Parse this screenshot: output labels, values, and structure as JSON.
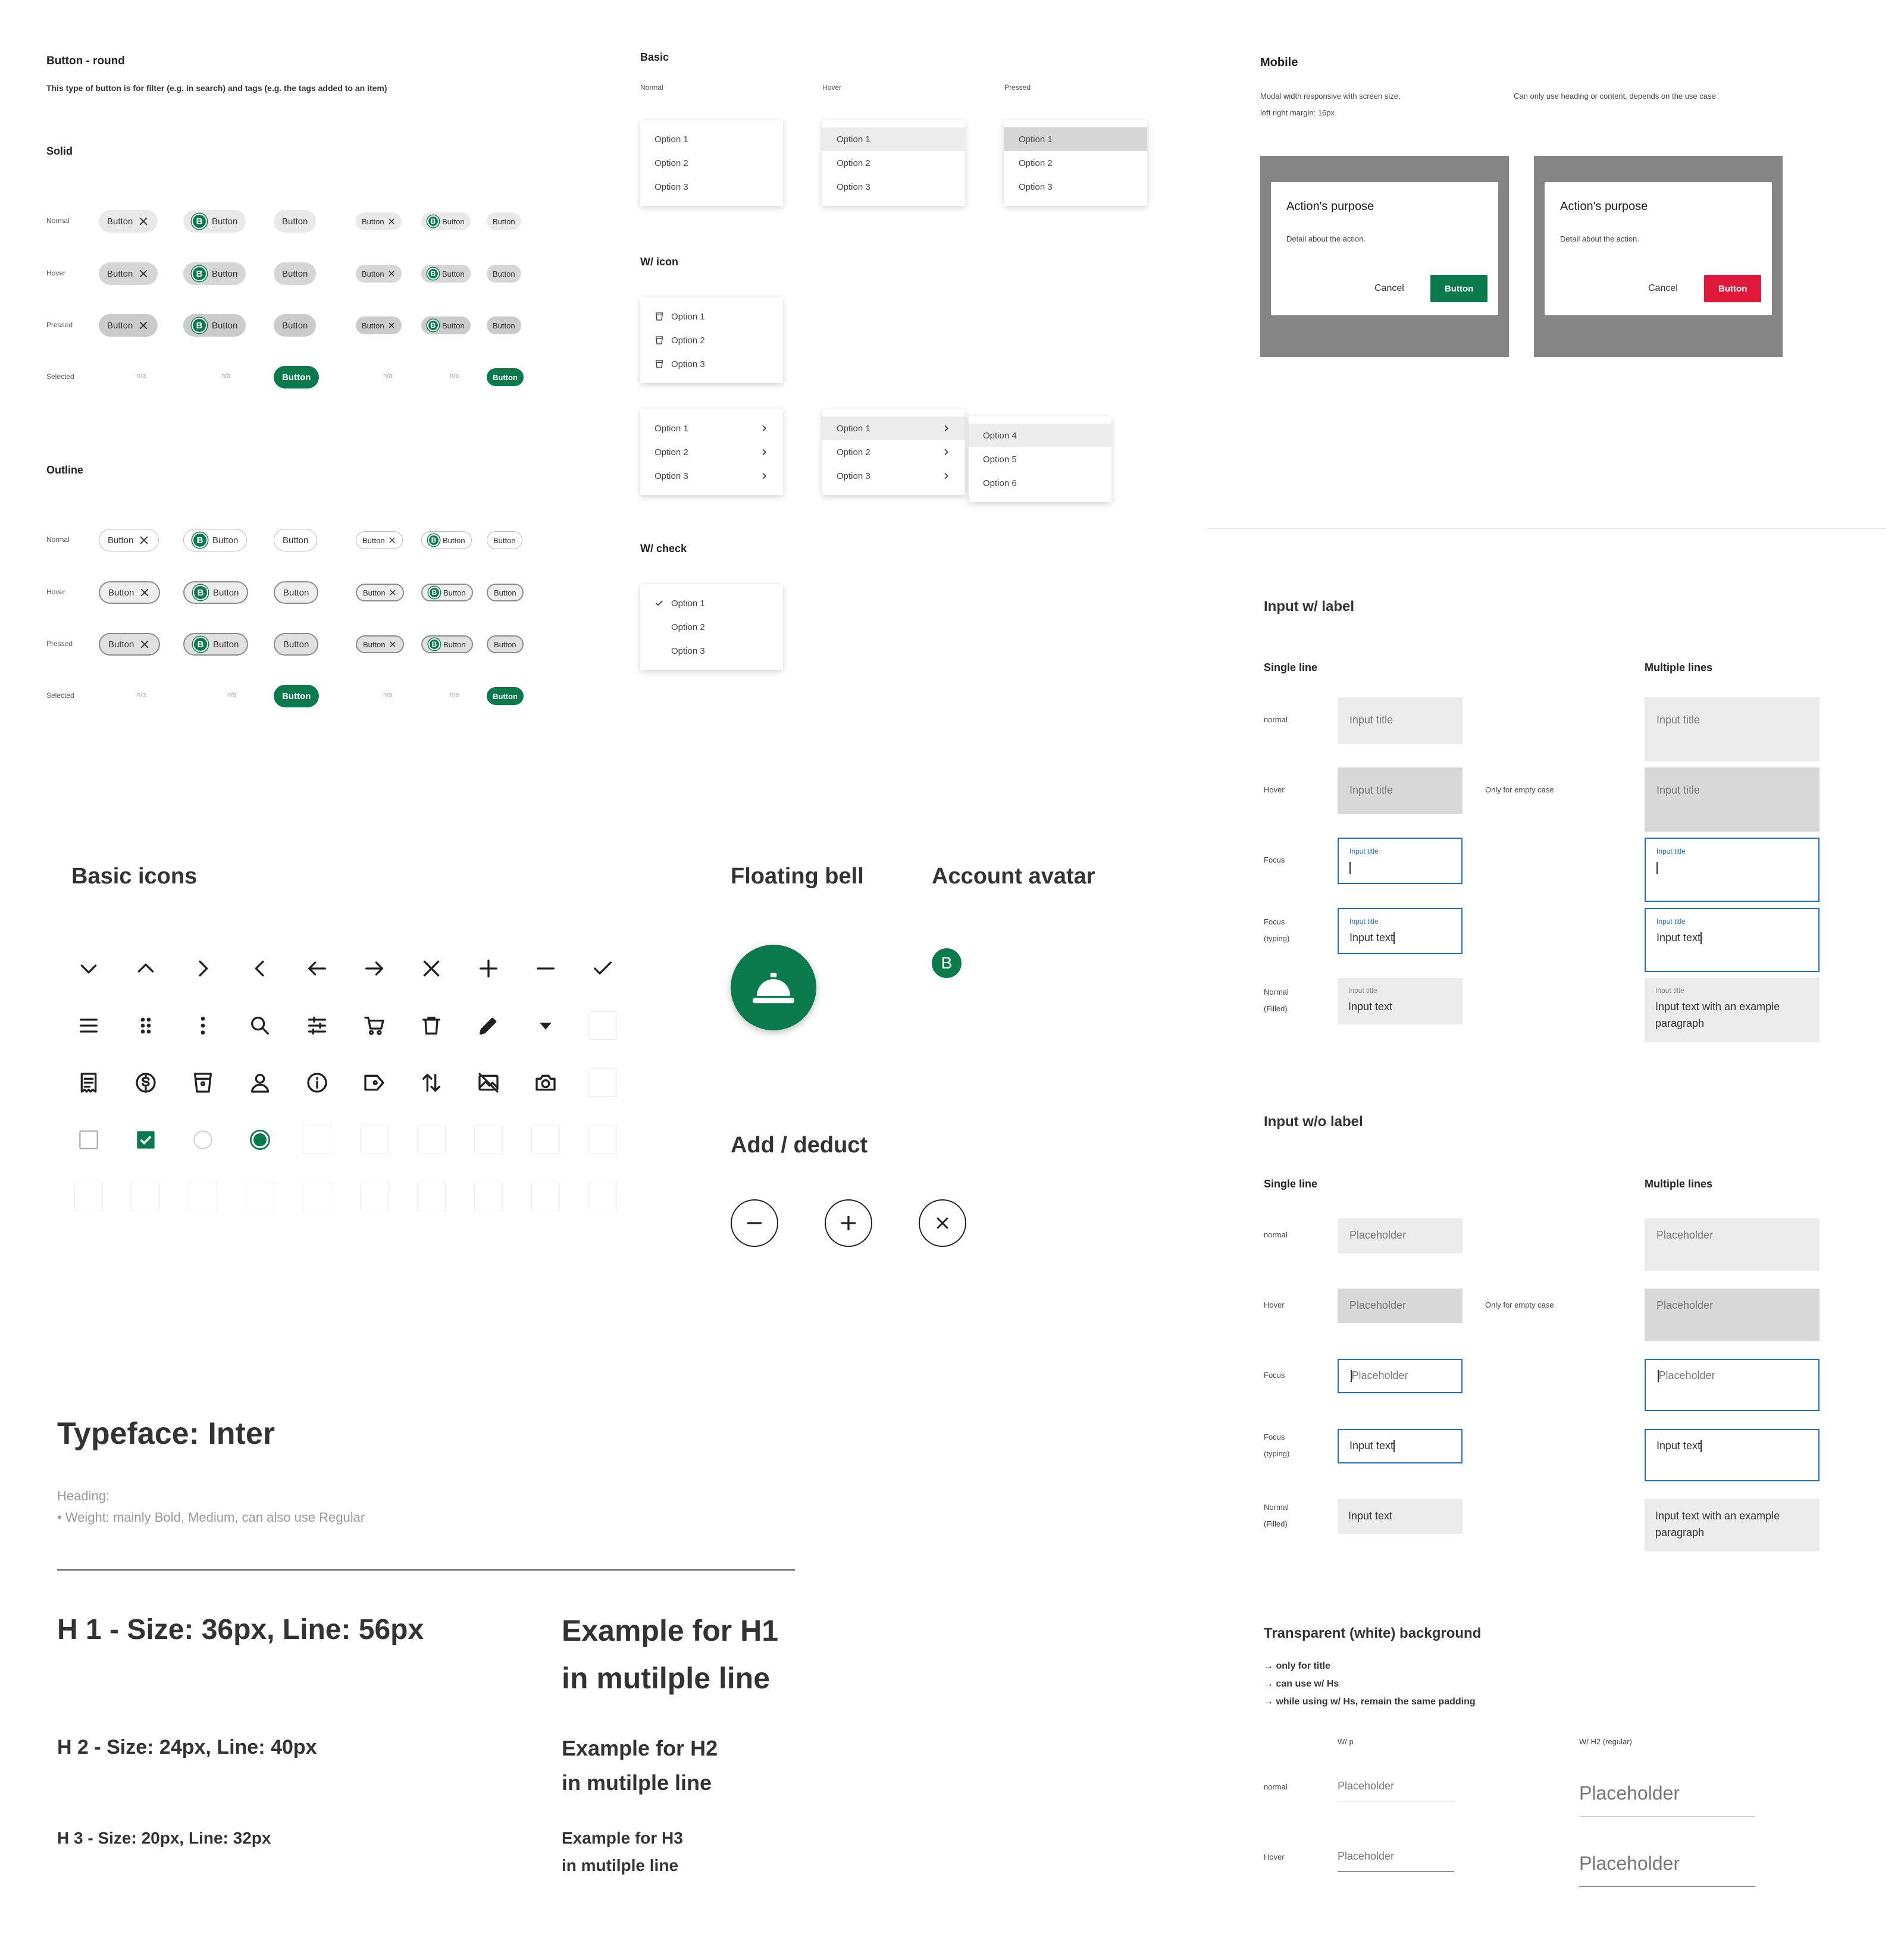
{
  "buttons_round": {
    "title": "Button - round",
    "description": "This type of button is for filter (e.g. in search) and tags (e.g. the tags added to an item)",
    "solid_title": "Solid",
    "outline_title": "Outline",
    "states": [
      "Normal",
      "Hover",
      "Pressed",
      "Selected"
    ],
    "button_label": "Button",
    "badge_letter": "B",
    "na": "n/a"
  },
  "dropdowns": {
    "basic_title": "Basic",
    "state_normal": "Normal",
    "state_hover": "Hover",
    "state_pressed": "Pressed",
    "icon_title": "W/ icon",
    "check_title": "W/ check",
    "options": [
      "Option 1",
      "Option 2",
      "Option 3"
    ],
    "sub_options": [
      "Option 4",
      "Option 5",
      "Option 6"
    ]
  },
  "mobile": {
    "title": "Mobile",
    "note_left_1": "Modal width responsive with screen size,",
    "note_left_2": "left right margin: 16px",
    "note_right": "Can only use heading or content, depends on the use case",
    "modal_title": "Action's purpose",
    "modal_detail": "Detail about the action.",
    "cancel": "Cancel",
    "button": "Button",
    "primary_color": "#0a7a4c",
    "danger_color": "#e0183a"
  },
  "icons": {
    "title": "Basic icons",
    "row1": [
      "chevron-down-icon",
      "chevron-up-icon",
      "chevron-right-icon",
      "chevron-left-icon",
      "arrow-left-icon",
      "arrow-right-icon",
      "close-icon",
      "plus-icon",
      "minus-icon",
      "check-icon"
    ],
    "row2": [
      "menu-icon",
      "drag-handle-icon",
      "more-vertical-icon",
      "search-icon",
      "filter-sliders-icon",
      "cart-icon",
      "trash-icon",
      "edit-pencil-icon",
      "caret-down-icon"
    ],
    "row3": [
      "receipt-icon",
      "dollar-icon",
      "cup-icon",
      "user-icon",
      "info-icon",
      "tag-icon",
      "sort-icon",
      "image-off-icon",
      "camera-icon"
    ]
  },
  "floating_bell": {
    "title": "Floating bell"
  },
  "account_avatar": {
    "title": "Account avatar",
    "letter": "B"
  },
  "add_deduct": {
    "title": "Add / deduct"
  },
  "typeface": {
    "title": "Typeface: Inter",
    "heading_label": "Heading:",
    "heading_weight": "• Weight: mainly Bold, Medium, can also use Regular",
    "h1": "H 1 - Size: 36px, Line: 56px",
    "h1_example_1": "Example for H1",
    "h1_example_2": "in mutilple line",
    "h2": "H 2 - Size: 24px, Line: 40px",
    "h2_example_1": "Example for H2",
    "h2_example_2": "in mutilple line",
    "h3": "H 3 - Size: 20px, Line: 32px",
    "h3_example_1": "Example for H3",
    "h3_example_2": "in mutilple line"
  },
  "input_label": {
    "title": "Input w/ label",
    "single": "Single line",
    "multiple": "Multiple lines",
    "states": [
      "normal",
      "Hover",
      "Focus",
      "Focus",
      "Normal"
    ],
    "state_sub": [
      "",
      "",
      "",
      "(typing)",
      "(Filled)"
    ],
    "input_title": "Input title",
    "input_text": "Input text",
    "multi_text_1": "Input text with an example",
    "multi_text_2": "paragraph",
    "only_empty": "Only for empty case"
  },
  "input_nolabel": {
    "title": "Input w/o label",
    "single": "Single line",
    "multiple": "Multiple lines",
    "placeholder": "Placeholder",
    "input_text": "Input text",
    "multi_text_1": "Input text with an example",
    "multi_text_2": "paragraph",
    "only_empty": "Only for empty case"
  },
  "transparent": {
    "title": "Transparent (white) background",
    "note1": "→ only for title",
    "note2": "→ can use w/ Hs",
    "note3": "→ while using w/ Hs, remain the same padding",
    "col_p": "W/ p",
    "col_h2": "W/ H2 (regular)",
    "state_normal": "normal",
    "state_hover": "Hover",
    "placeholder": "Placeholder"
  }
}
